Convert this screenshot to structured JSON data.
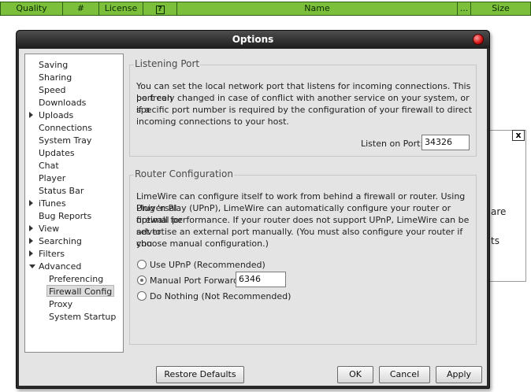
{
  "columns": {
    "quality": "Quality",
    "number": "#",
    "license": "License",
    "info_icon": "?",
    "name": "Name",
    "more": "...",
    "size": "Size"
  },
  "background_dialog": {
    "close_label": "x",
    "fragment_1": "are",
    "fragment_2": "ts"
  },
  "window": {
    "title": "Options"
  },
  "tree": {
    "items": [
      {
        "label": "Saving",
        "expander": "none"
      },
      {
        "label": "Sharing",
        "expander": "none"
      },
      {
        "label": "Speed",
        "expander": "none"
      },
      {
        "label": "Downloads",
        "expander": "none"
      },
      {
        "label": "Uploads",
        "expander": "collapsed"
      },
      {
        "label": "Connections",
        "expander": "none"
      },
      {
        "label": "System Tray",
        "expander": "none"
      },
      {
        "label": "Updates",
        "expander": "none"
      },
      {
        "label": "Chat",
        "expander": "none"
      },
      {
        "label": "Player",
        "expander": "none"
      },
      {
        "label": "Status Bar",
        "expander": "none"
      },
      {
        "label": "iTunes",
        "expander": "collapsed"
      },
      {
        "label": "Bug Reports",
        "expander": "none"
      },
      {
        "label": "View",
        "expander": "collapsed"
      },
      {
        "label": "Searching",
        "expander": "collapsed"
      },
      {
        "label": "Filters",
        "expander": "collapsed"
      },
      {
        "label": "Advanced",
        "expander": "expanded"
      },
      {
        "label": "Preferencing",
        "expander": "child"
      },
      {
        "label": "Firewall Config",
        "expander": "child",
        "selected": true
      },
      {
        "label": "Proxy",
        "expander": "child"
      },
      {
        "label": "System Startup",
        "expander": "child"
      }
    ]
  },
  "listening_port": {
    "title": "Listening Port",
    "description_lines": [
      "You can set the local network port that listens for incoming connections. This port can",
      "be freely changed in case of conflict with another service on your system, or if a",
      "specific port number is required by the configuration of your firewall to direct",
      "incoming connections to your host."
    ],
    "port_label": "Listen on Port:",
    "port_value": "34326"
  },
  "router_config": {
    "title": "Router Configuration",
    "description_lines": [
      "LimeWire can configure itself to work from behind a firewall or router. Using Universal",
      "Plug 'n Play (UPnP), LimeWire can automatically configure your router or firewall for",
      "optimal performance. If your router does not support UPnP, LimeWire can be set to",
      "advertise an external port manually. (You must also configure your router if you",
      "choose manual configuration.)"
    ],
    "options": [
      {
        "label": "Use UPnP (Recommended)",
        "selected": false
      },
      {
        "label": "Manual Port Forward:",
        "selected": true
      },
      {
        "label": "Do Nothing (Not Recommended)",
        "selected": false
      }
    ],
    "manual_port_value": "6346"
  },
  "buttons": {
    "restore": "Restore Defaults",
    "ok": "OK",
    "cancel": "Cancel",
    "apply": "Apply"
  }
}
